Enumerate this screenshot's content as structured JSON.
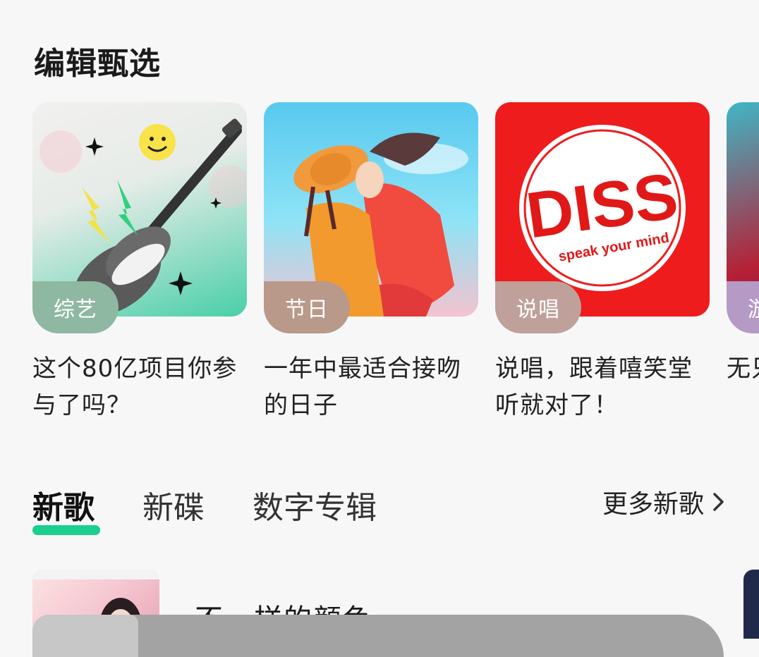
{
  "editorial": {
    "title": "编辑甄选",
    "cards": [
      {
        "tag": "综艺",
        "tag_color": "#8fb8a2",
        "title": "这个80亿项目你参与了吗？"
      },
      {
        "tag": "节日",
        "tag_color": "#b9998a",
        "title": "一年中最适合接吻的日子"
      },
      {
        "tag": "说唱",
        "tag_color": "#bfa09a",
        "title": "说唱，跟着嘻笑堂听就对了！"
      },
      {
        "tag": "游",
        "tag_color": "#b59ac6",
        "title": "无只！"
      }
    ],
    "diss_text": "DISS",
    "diss_sub": "speak your mind"
  },
  "tabs": {
    "items": [
      "新歌",
      "新碟",
      "数字专辑"
    ],
    "active": "新歌",
    "more_label": "更多新歌",
    "accent": "#1ccf8f"
  },
  "song_list": {
    "first_title": "不一样的颜色"
  }
}
